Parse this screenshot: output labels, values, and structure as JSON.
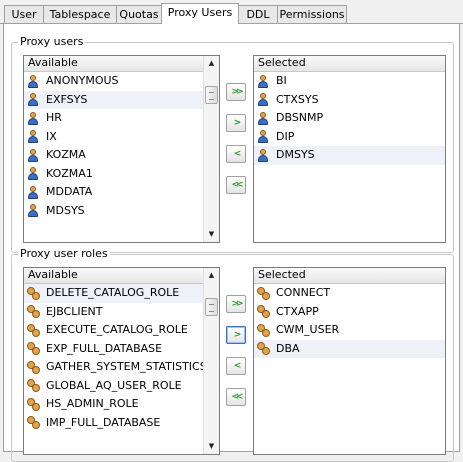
{
  "tabs": [
    "User",
    "Tablespace",
    "Quotas",
    "Proxy Users",
    "DDL",
    "Permissions"
  ],
  "active_tab": "Proxy Users",
  "proxy_users": {
    "title": "Proxy users",
    "available_header": "Available",
    "selected_header": "Selected",
    "available": [
      "ANONYMOUS",
      "EXFSYS",
      "HR",
      "IX",
      "KOZMA",
      "KOZMA1",
      "MDDATA",
      "MDSYS"
    ],
    "selected": [
      "BI",
      "CTXSYS",
      "DBSNMP",
      "DIP",
      "DMSYS"
    ]
  },
  "proxy_roles": {
    "title": "Proxy user roles",
    "available_header": "Available",
    "selected_header": "Selected",
    "available": [
      "DELETE_CATALOG_ROLE",
      "EJBCLIENT",
      "EXECUTE_CATALOG_ROLE",
      "EXP_FULL_DATABASE",
      "GATHER_SYSTEM_STATISTICS",
      "GLOBAL_AQ_USER_ROLE",
      "HS_ADMIN_ROLE",
      "IMP_FULL_DATABASE"
    ],
    "selected": [
      "CONNECT",
      "CTXAPP",
      "CWM_USER",
      "DBA"
    ]
  },
  "move_buttons": [
    ">>",
    ">",
    "<",
    "<<"
  ],
  "icons": {
    "user_icon": "user-icon",
    "role_icon": "role-icon",
    "scroll_up": "scroll-up-icon",
    "scroll_down": "scroll-down-icon"
  },
  "colors": {
    "arrow": "#2e9b2e",
    "focus": "#3a6ec7",
    "row_highlight": "#eef1f8"
  }
}
